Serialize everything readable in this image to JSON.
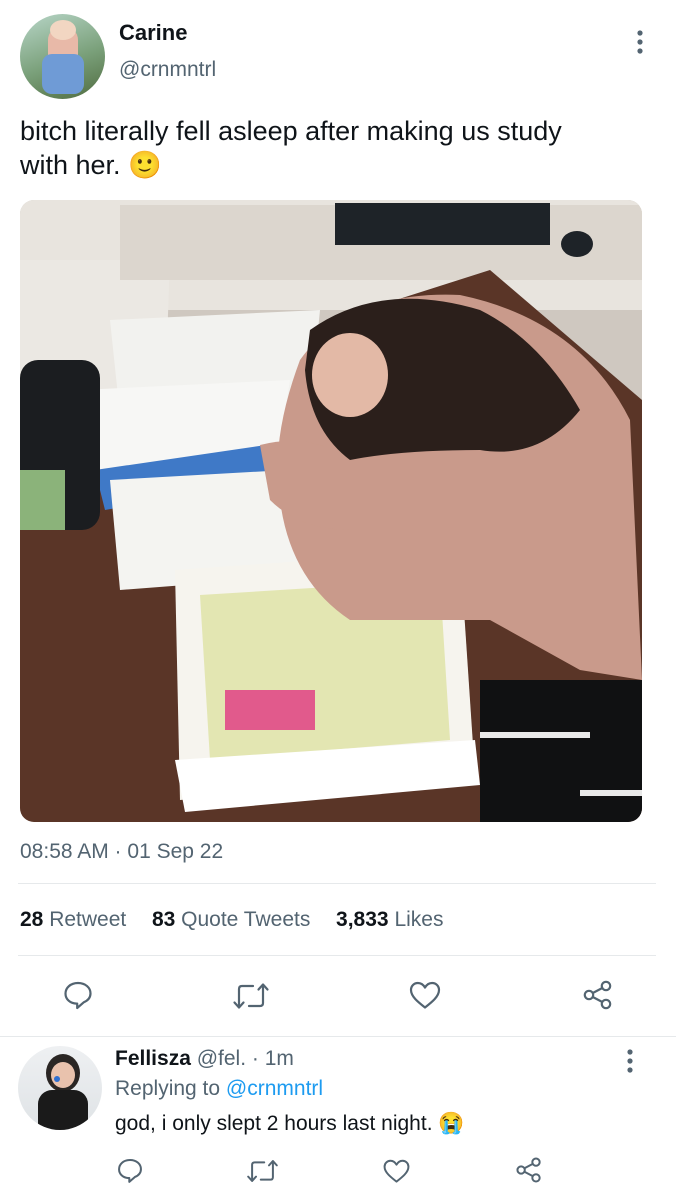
{
  "tweet": {
    "author_name": "Carine",
    "author_handle": "@crnmntrl",
    "text_line1": "bitch literally fell asleep after making us study",
    "text_line2": "with her.",
    "text_emoji": "🙂",
    "timestamp": "08:58 AM · 01 Sep 22",
    "stats": {
      "retweets_count": "28",
      "retweets_label": "Retweet",
      "quotes_count": "83",
      "quotes_label": "Quote Tweets",
      "likes_count": "3,833",
      "likes_label": "Likes"
    },
    "icons": [
      "comment-icon",
      "retweet-icon",
      "like-icon",
      "share-icon",
      "more-icon"
    ]
  },
  "reply": {
    "author_name": "Fellisza",
    "author_handle": "@fel.",
    "time_sep": "·",
    "time": "1m",
    "replying_prefix": "Replying to",
    "replying_handle": "@crnmntrl",
    "text": "god, i only slept 2 hours last night.",
    "text_emoji": "😭"
  },
  "colors": {
    "accent": "#1d9bf0",
    "muted": "#536471",
    "icon": "#536471"
  }
}
